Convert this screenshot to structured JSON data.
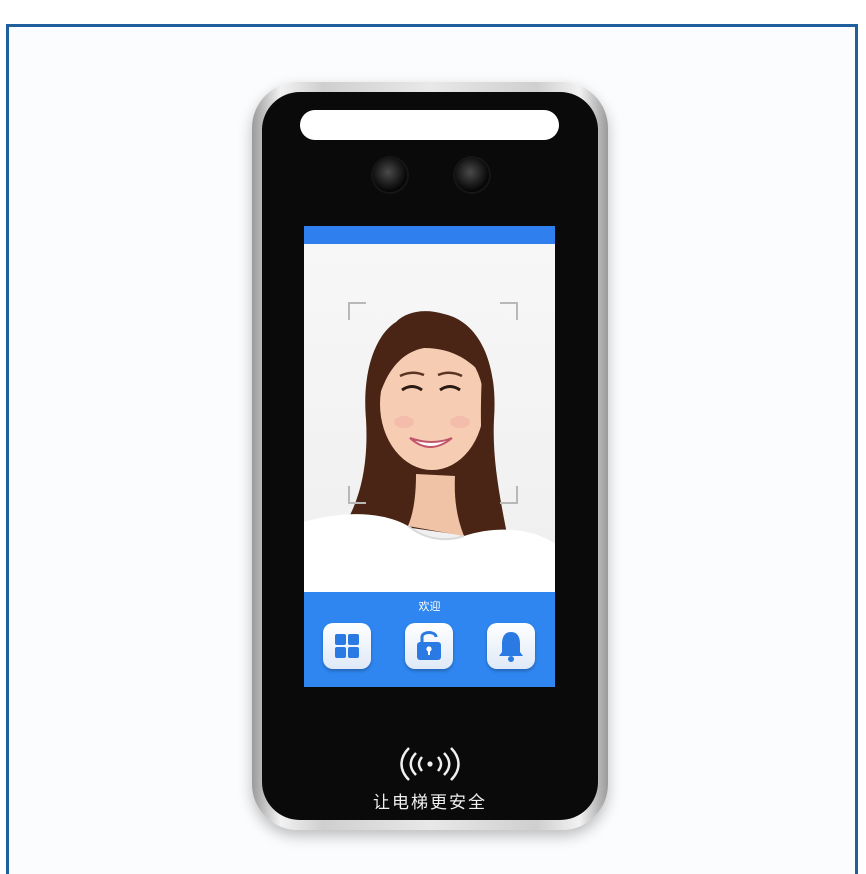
{
  "device": {
    "screen": {
      "welcome_text": "欢迎",
      "buttons": [
        {
          "icon": "grid-menu-icon"
        },
        {
          "icon": "unlock-icon"
        },
        {
          "icon": "bell-icon"
        }
      ]
    },
    "nfc": {
      "icon": "nfc-contactless-icon",
      "label": "让电梯更安全"
    }
  },
  "colors": {
    "frame_border": "#1f5f9e",
    "screen_accent": "#2f86f0",
    "device_body": "#0a0a0a"
  }
}
